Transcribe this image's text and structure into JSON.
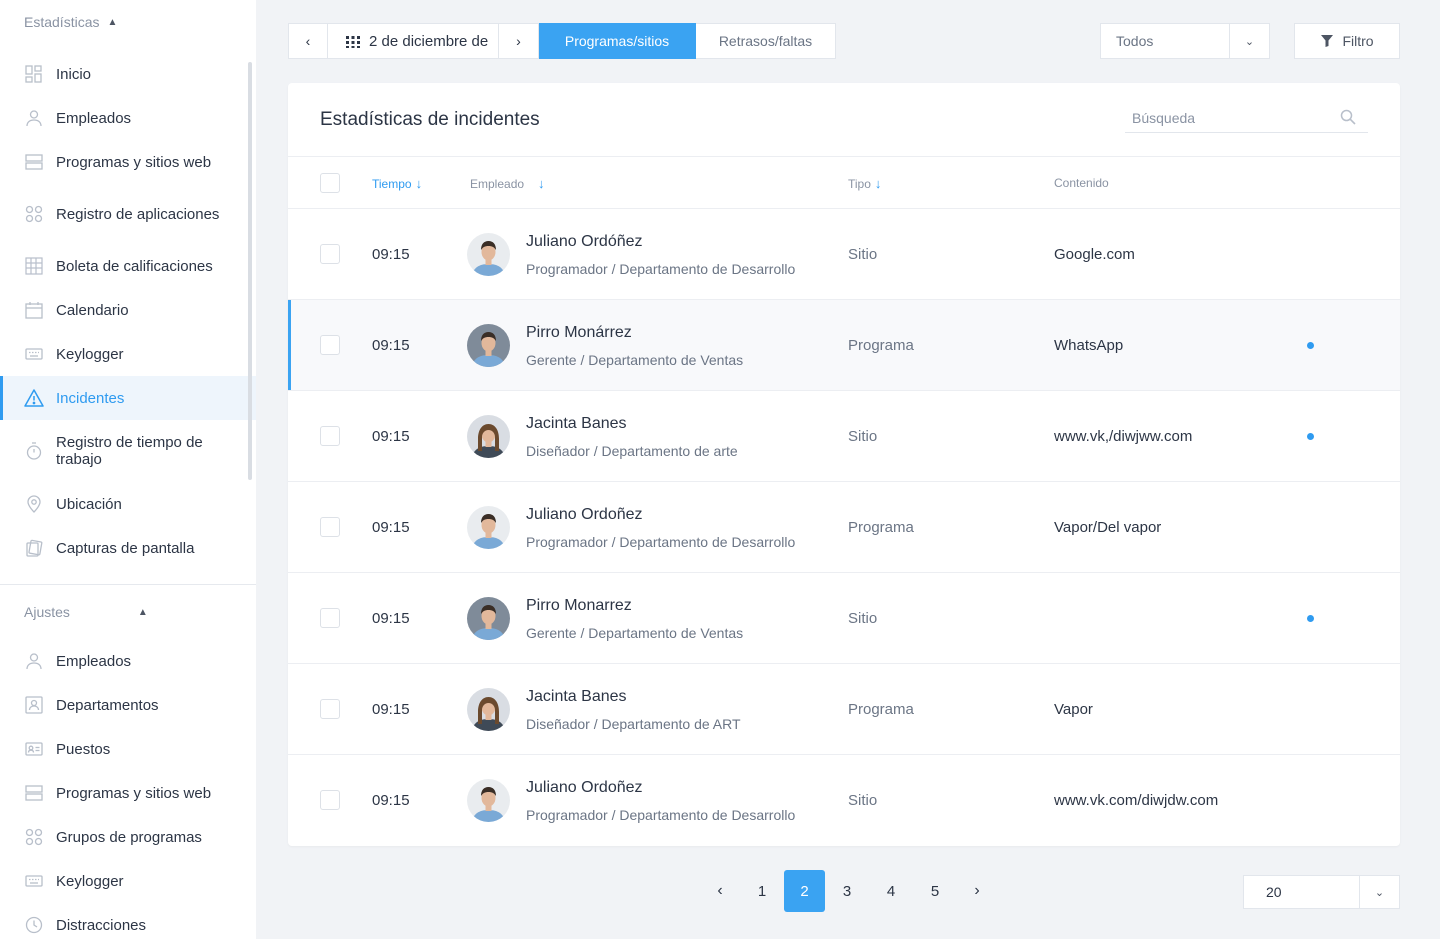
{
  "sidebar": {
    "stats_section": "Estadísticas",
    "stats_items": [
      {
        "label": "Inicio",
        "icon": "dashboard-icon"
      },
      {
        "label": "Empleados",
        "icon": "user-icon"
      },
      {
        "label": "Programas y sitios web",
        "icon": "server-icon"
      },
      {
        "label": "Registro de aplicaciones",
        "icon": "apps-grid-icon"
      },
      {
        "label": "Boleta de calificaciones",
        "icon": "table-grid-icon"
      },
      {
        "label": "Calendario",
        "icon": "calendar-icon"
      },
      {
        "label": "Keylogger",
        "icon": "keyboard-icon"
      },
      {
        "label": "Incidentes",
        "icon": "warning-icon",
        "active": true
      },
      {
        "label": "Registro de tiempo de trabajo",
        "icon": "stopwatch-icon"
      },
      {
        "label": "Ubicación",
        "icon": "location-pin-icon"
      },
      {
        "label": "Capturas de pantalla",
        "icon": "screenshots-icon"
      }
    ],
    "settings_section": "Ajustes",
    "settings_items": [
      {
        "label": "Empleados",
        "icon": "user-icon"
      },
      {
        "label": "Departamentos",
        "icon": "department-icon"
      },
      {
        "label": "Puestos",
        "icon": "id-card-icon"
      },
      {
        "label": "Programas y sitios web",
        "icon": "server-icon"
      },
      {
        "label": "Grupos de programas",
        "icon": "apps-grid-icon"
      },
      {
        "label": "Keylogger",
        "icon": "keyboard-icon"
      },
      {
        "label": "Distracciones",
        "icon": "clock-icon"
      }
    ]
  },
  "toolbar": {
    "prev": "‹",
    "date": "2 de diciembre de",
    "next": "›",
    "tab_programs": "Programas/sitios",
    "tab_delays": "Retrasos/faltas",
    "select_value": "Todos",
    "filter_label": "Filtro"
  },
  "card": {
    "title": "Estadísticas de incidentes",
    "search_placeholder": "Búsqueda",
    "columns": {
      "time": "Tiempo",
      "employee": "Empleado",
      "type": "Tipo",
      "content": "Contenido"
    },
    "rows": [
      {
        "time": "09:15",
        "name": "Juliano Ordóñez",
        "role": "Programador / Departamento de Desarrollo",
        "type": "Sitio",
        "content": "Google.com",
        "dot": false,
        "selected": false,
        "avatar": "male"
      },
      {
        "time": "09:15",
        "name": "Pirro Monárrez",
        "role": "Gerente / Departamento de Ventas",
        "type": "Programa",
        "content": "WhatsApp",
        "dot": true,
        "selected": true,
        "avatar": "male2"
      },
      {
        "time": "09:15",
        "name": "Jacinta Banes",
        "role": "Diseñador / Departamento de arte",
        "type": "Sitio",
        "content": "www.vk,/diwjww.com",
        "dot": true,
        "selected": false,
        "avatar": "female"
      },
      {
        "time": "09:15",
        "name": "Juliano Ordoñez",
        "role": "Programador / Departamento de Desarrollo",
        "type": "Programa",
        "content": "Vapor/Del vapor",
        "dot": false,
        "selected": false,
        "avatar": "male"
      },
      {
        "time": "09:15",
        "name": "Pirro Monarrez",
        "role": "Gerente / Departamento de Ventas",
        "type": "Sitio",
        "content": "",
        "dot": true,
        "selected": false,
        "avatar": "male2"
      },
      {
        "time": "09:15",
        "name": "Jacinta Banes",
        "role": "Diseñador / Departamento de ART",
        "type": "Programa",
        "content": "Vapor",
        "dot": false,
        "selected": false,
        "avatar": "female"
      },
      {
        "time": "09:15",
        "name": "Juliano Ordoñez",
        "role": "Programador / Departamento de Desarrollo",
        "type": "Sitio",
        "content": "www.vk.com/diwjdw.com",
        "dot": false,
        "selected": false,
        "avatar": "male"
      }
    ]
  },
  "pagination": {
    "prev": "‹",
    "pages": [
      "1",
      "2",
      "3",
      "4",
      "5"
    ],
    "current": "2",
    "next": "›",
    "per_page": "20"
  },
  "colors": {
    "accent": "#3aa3f2",
    "text": "#2c3545",
    "muted": "#8a93a3",
    "background": "#f1f3f6"
  }
}
